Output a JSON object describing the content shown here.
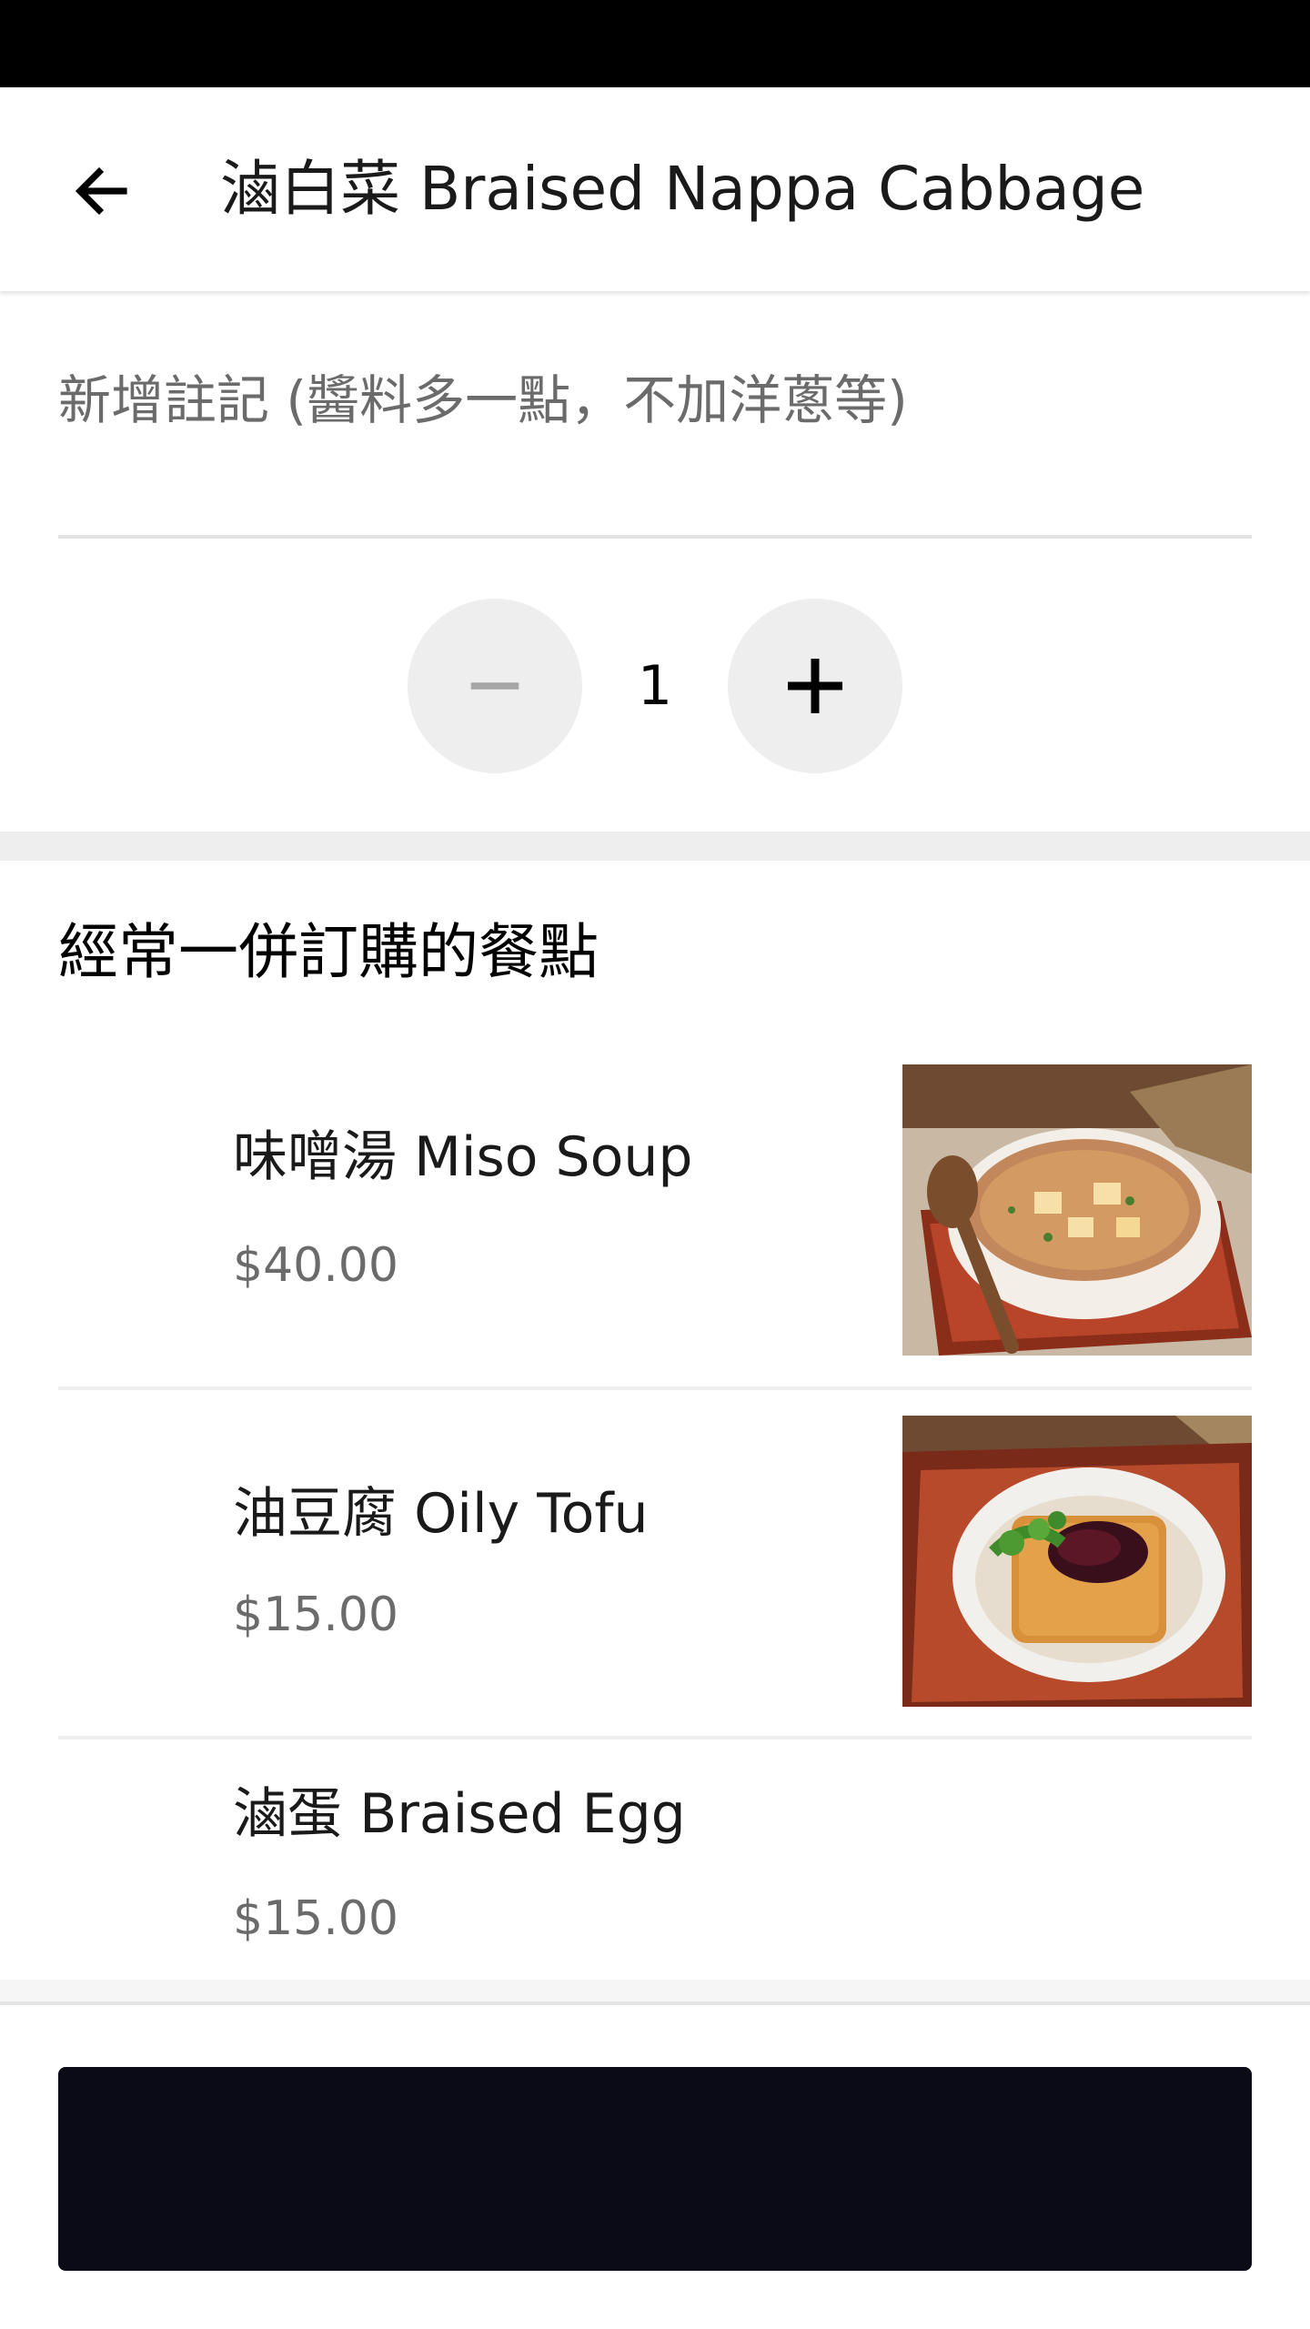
{
  "header": {
    "title": "滷白菜 Braised Nappa Cabbage",
    "back_icon": "arrow-left-icon"
  },
  "note": {
    "placeholder": "新增註記 (醬料多一點，不加洋蔥等)",
    "value": ""
  },
  "quantity": {
    "value": "1",
    "decrement_icon": "minus-icon",
    "increment_icon": "plus-icon"
  },
  "frequently_ordered": {
    "title": "經常一併訂購的餐點",
    "items": [
      {
        "name": "味噌湯 Miso Soup",
        "price": "$40.00",
        "has_image": true
      },
      {
        "name": "油豆腐 Oily Tofu",
        "price": "$15.00",
        "has_image": true
      },
      {
        "name": "滷蛋 Braised Egg",
        "price": "$15.00",
        "has_image": false
      }
    ]
  },
  "bottom_bar": {
    "button_label": ""
  },
  "colors": {
    "status_bar": "#000000",
    "button": "#0b0b18",
    "stepper_bg": "#eeeeee",
    "price_text": "#6b6b6b"
  }
}
